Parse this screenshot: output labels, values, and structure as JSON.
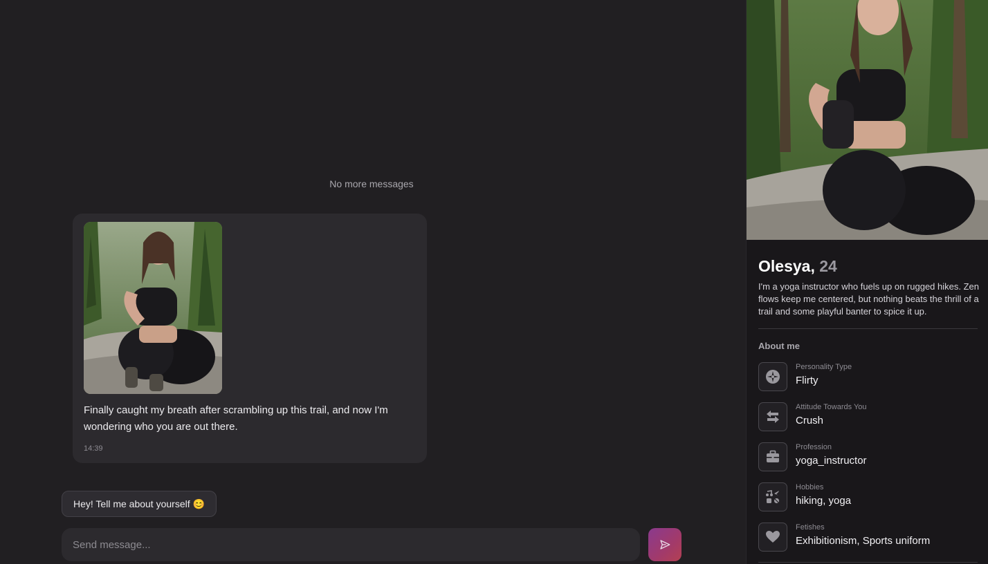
{
  "chat": {
    "status_text": "No more messages",
    "message": {
      "text": "Finally caught my breath after scrambling up this trail, and now I'm wondering who you are out there.",
      "time": "14:39"
    },
    "suggestion": "Hey! Tell me about yourself 😊",
    "composer_placeholder": "Send message..."
  },
  "profile": {
    "name": "Olesya,",
    "age": "24",
    "bio": "I'm a yoga instructor who fuels up on rugged hikes. Zen flows keep me centered, but nothing beats the thrill of a trail and some playful banter to spice it up.",
    "about_title": "About me",
    "traits": [
      {
        "label": "Personality Type",
        "value": "Flirty",
        "icon": "compass-icon"
      },
      {
        "label": "Attitude Towards You",
        "value": "Crush",
        "icon": "arrows-exchange-icon"
      },
      {
        "label": "Profession",
        "value": "yoga_instructor",
        "icon": "briefcase-icon"
      },
      {
        "label": "Hobbies",
        "value": "hiking, yoga",
        "icon": "hobbies-icon"
      },
      {
        "label": "Fetishes",
        "value": "Exhibitionism, Sports uniform",
        "icon": "heart-icon"
      }
    ]
  },
  "colors": {
    "background": "#211f22",
    "bubble": "#2c2a2e",
    "panel": "#19171a",
    "send_gradient_start": "#8a3a8e",
    "send_gradient_end": "#b34052"
  }
}
